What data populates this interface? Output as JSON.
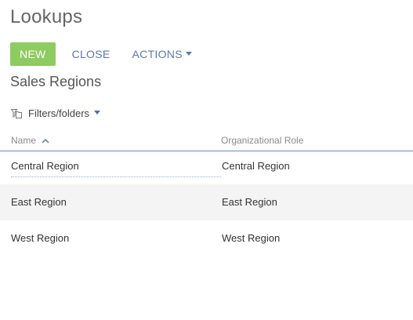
{
  "page": {
    "title": "Lookups"
  },
  "toolbar": {
    "new_label": "NEW",
    "close_label": "CLOSE",
    "actions_label": "ACTIONS"
  },
  "section": {
    "title": "Sales Regions"
  },
  "filters": {
    "label": "Filters/folders",
    "icon": "filter-folder-icon"
  },
  "grid": {
    "columns": [
      {
        "label": "Name",
        "sort": "ascending"
      },
      {
        "label": "Organizational Role"
      }
    ],
    "rows": [
      {
        "name": "Central Region",
        "role": "Central Region",
        "selected": true
      },
      {
        "name": "East Region",
        "role": "East Region"
      },
      {
        "name": "West Region",
        "role": "West Region"
      }
    ]
  },
  "colors": {
    "new_button": "#8ecb60",
    "link": "#5b78b8",
    "divider": "#5b8fd0",
    "alt_row": "#f4f4f4"
  }
}
